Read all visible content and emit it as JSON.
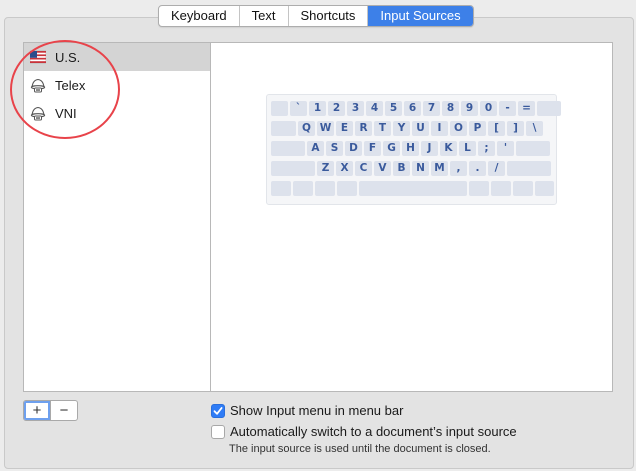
{
  "tabs": [
    {
      "label": "Keyboard"
    },
    {
      "label": "Text"
    },
    {
      "label": "Shortcuts"
    },
    {
      "label": "Input Sources"
    }
  ],
  "active_tab": "Input Sources",
  "input_sources": [
    {
      "label": "U.S.",
      "icon": "us-flag-icon",
      "selected": true
    },
    {
      "label": "Telex",
      "icon": "vietnamese-input-icon",
      "selected": false
    },
    {
      "label": "VNI",
      "icon": "vietnamese-input-icon",
      "selected": false
    }
  ],
  "keyboard": {
    "rows": [
      [
        "",
        "`",
        "1",
        "2",
        "3",
        "4",
        "5",
        "6",
        "7",
        "8",
        "9",
        "0",
        "-",
        "=",
        ""
      ],
      [
        "",
        "Q",
        "W",
        "E",
        "R",
        "T",
        "Y",
        "U",
        "I",
        "O",
        "P",
        "[",
        "]",
        "\\"
      ],
      [
        "",
        "A",
        "S",
        "D",
        "F",
        "G",
        "H",
        "J",
        "K",
        "L",
        ";",
        "'",
        ""
      ],
      [
        "",
        "Z",
        "X",
        "C",
        "V",
        "B",
        "N",
        "M",
        ",",
        ".",
        "/",
        ""
      ]
    ]
  },
  "buttons": {
    "add": "+",
    "remove": "−"
  },
  "options": {
    "show_menu": {
      "label": "Show Input menu in menu bar",
      "checked": true
    },
    "auto_switch": {
      "label": "Automatically switch to a document’s input source",
      "checked": false
    },
    "hint": "The input source is used until the document is closed."
  },
  "colors": {
    "accent": "#3d80e8",
    "annotation": "#e8434a",
    "key_text": "#3a5a9c"
  }
}
